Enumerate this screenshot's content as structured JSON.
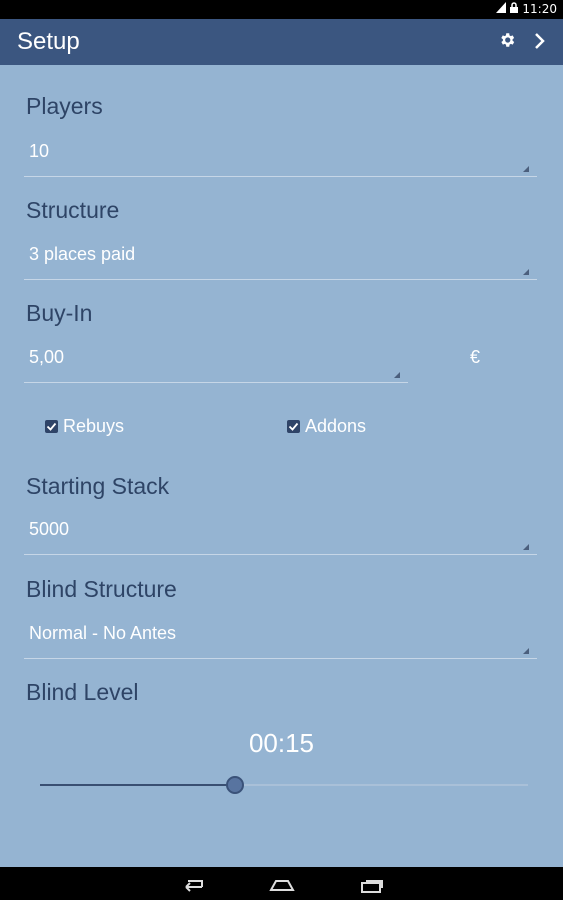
{
  "status_bar": {
    "time": "11:20",
    "icons": [
      "signal-icon",
      "lock-icon"
    ]
  },
  "action_bar": {
    "title": "Setup",
    "icons": [
      "gear-icon",
      "chevron-right-icon"
    ]
  },
  "players": {
    "label": "Players",
    "value": "10"
  },
  "structure": {
    "label": "Structure",
    "value": "3 places paid"
  },
  "buyin": {
    "label": "Buy-In",
    "value": "5,00",
    "currency": "€"
  },
  "rebuys": {
    "label": "Rebuys",
    "checked": true
  },
  "addons": {
    "label": "Addons",
    "checked": true
  },
  "starting_stack": {
    "label": "Starting Stack",
    "value": "5000"
  },
  "blind_structure": {
    "label": "Blind Structure",
    "value": "Normal - No Antes"
  },
  "blind_level": {
    "label": "Blind Level",
    "value": "00:15",
    "slider_fraction": 0.4
  },
  "nav_bar": {
    "icons": [
      "back-icon",
      "home-icon",
      "recents-icon"
    ]
  },
  "colors": {
    "action_bar": "#3b5680",
    "background": "#95b4d2",
    "label": "#2e4466"
  }
}
